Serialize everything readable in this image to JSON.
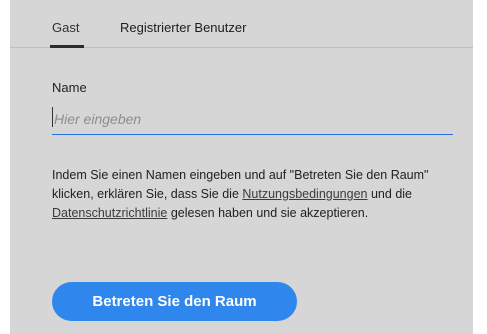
{
  "tabs": {
    "guest": "Gast",
    "registered": "Registrierter Benutzer"
  },
  "form": {
    "name_label": "Name",
    "name_placeholder": "Hier eingeben",
    "name_value": ""
  },
  "terms": {
    "part1": "Indem Sie einen Namen eingeben und auf \"Betreten Sie den Raum\" klicken, erklären Sie, dass Sie die",
    "terms_link": "Nutzungsbedingungen",
    "part2": "und die",
    "privacy_link": "Datenschutzrichtlinie",
    "part3": "gelesen haben und sie akzeptieren."
  },
  "actions": {
    "enter_room": "Betreten Sie den Raum"
  },
  "colors": {
    "panel_bg": "#d6d6d6",
    "accent": "#2f86ec",
    "input_underline": "#2b6ee0"
  }
}
